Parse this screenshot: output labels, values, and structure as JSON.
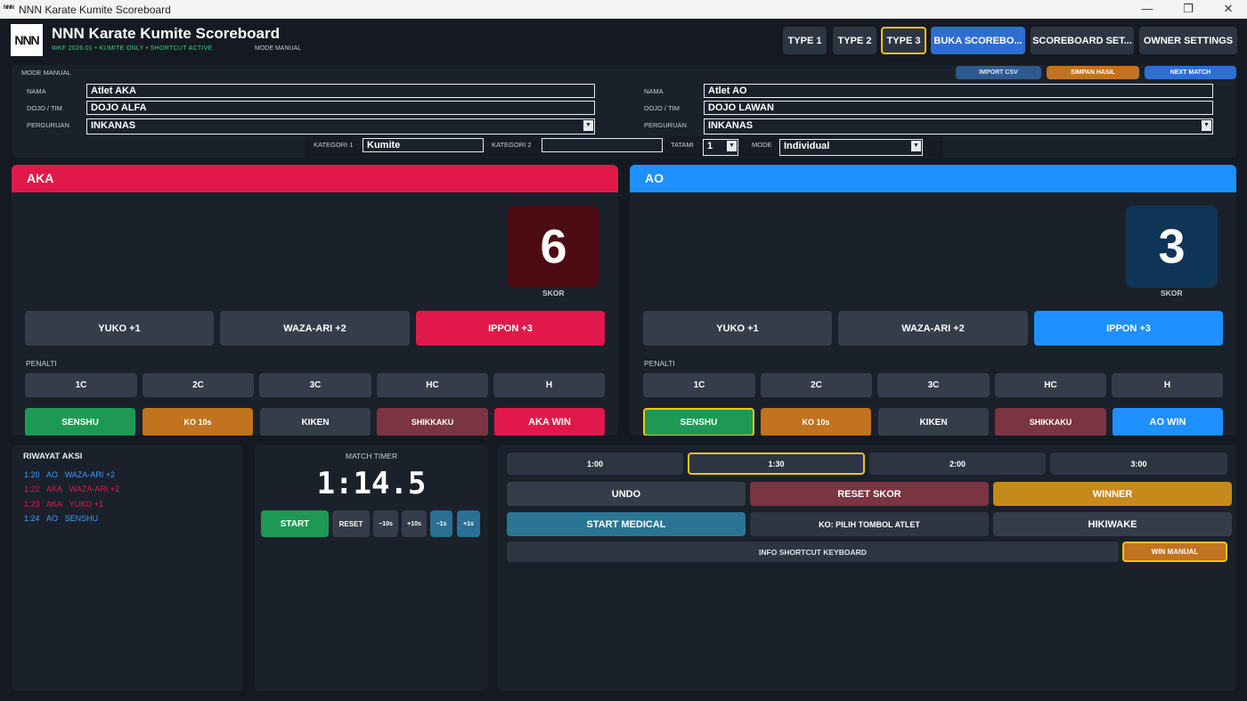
{
  "window": {
    "title": "NNN Karate Kumite Scoreboard",
    "icon_text": "NNN",
    "controls": [
      "minimize-icon",
      "maximize-icon",
      "close-icon"
    ]
  },
  "header": {
    "logo": "NNN",
    "title": "NNN Karate Kumite Scoreboard",
    "subtitle": "WKF 2026.01 • KUMITE ONLY • SHORTCUT ACTIVE",
    "mode": "MODE MANUAL",
    "buttons": {
      "type1": "TYPE 1",
      "type2": "TYPE 2",
      "type3": "TYPE 3",
      "open_scoreboard": "BUKA SCOREBO...",
      "scoreboard_settings": "SCOREBOARD SET...",
      "owner_settings": "OWNER SETTINGS"
    },
    "selected_type": "TYPE 3"
  },
  "info": {
    "mode_label": "MODE MANUAL",
    "import_csv": "IMPORT CSV",
    "save_result": "SIMPAN HASIL",
    "next_match": "NEXT MATCH",
    "aka": {
      "name_label": "NAMA",
      "name": "Atlet AKA",
      "dojo_label": "DOJO / TIM",
      "dojo": "DOJO ALFA",
      "school_label": "PERGURUAN",
      "school": "INKANAS"
    },
    "ao": {
      "name_label": "NAMA",
      "name": "Atlet AO",
      "dojo_label": "DOJO / TIM",
      "dojo": "DOJO LAWAN",
      "school_label": "PERGURUAN",
      "school": "INKANAS"
    },
    "category1_label": "KATEGORI 1",
    "category1": "Kumite",
    "category2_label": "KATEGORI 2",
    "category2": "",
    "tatami_label": "TATAMI",
    "tatami": "1",
    "mode_select_label": "MODE",
    "mode_select": "Individual"
  },
  "aka": {
    "header": "AKA",
    "score": "6",
    "score_label": "SKOR",
    "yuko": "YUKO  +1",
    "waza_ari": "WAZA-ARI  +2",
    "ippon": "IPPON  +3",
    "penalty_label": "PENALTI",
    "penalties": [
      "1C",
      "2C",
      "3C",
      "HC",
      "H"
    ],
    "senshu": "SENSHU",
    "ko": "KO 10s",
    "kiken": "KIKEN",
    "shikkaku": "SHIKKAKU",
    "win": "AKA WIN"
  },
  "ao": {
    "header": "AO",
    "score": "3",
    "score_label": "SKOR",
    "yuko": "YUKO  +1",
    "waza_ari": "WAZA-ARI  +2",
    "ippon": "IPPON  +3",
    "penalty_label": "PENALTI",
    "penalties": [
      "1C",
      "2C",
      "3C",
      "HC",
      "H"
    ],
    "senshu": "SENSHU",
    "ko": "KO 10s",
    "kiken": "KIKEN",
    "shikkaku": "SHIKKAKU",
    "win": "AO WIN"
  },
  "history": {
    "title": "RIWAYAT AKSI",
    "entries": [
      {
        "time": "1:20",
        "side": "AO",
        "action": "WAZA-ARI +2"
      },
      {
        "time": "1:22",
        "side": "AKA",
        "action": "WAZA-ARI +2"
      },
      {
        "time": "1:23",
        "side": "AKA",
        "action": "YUKO +1"
      },
      {
        "time": "1:24",
        "side": "AO",
        "action": "SENSHU"
      }
    ]
  },
  "timer": {
    "title": "MATCH TIMER",
    "value": "1:14.5",
    "start": "START",
    "reset": "RESET",
    "minus10": "−10s",
    "plus10": "+10s",
    "minus1": "−1s",
    "plus1": "+1s"
  },
  "controls": {
    "durations": [
      "1:00",
      "1:30",
      "2:00",
      "3:00"
    ],
    "selected_duration": "1:30",
    "undo": "UNDO",
    "reset_score": "RESET SKOR",
    "winner": "WINNER",
    "start_medical": "START MEDICAL",
    "ko_pick": "KO: PILIH TOMBOL ATLET",
    "hikiwake": "HIKIWAKE",
    "shortcut_info": "INFO SHORTCUT KEYBOARD",
    "win_manual": "WIN MANUAL"
  },
  "colors": {
    "aka": "#e0194a",
    "ao": "#1e90ff",
    "selected_outline": "#f0c419",
    "senshu": "#1e9955",
    "ko": "#c1731f",
    "shikkaku": "#7a3540",
    "medical": "#2a7594",
    "winner": "#c68a1c"
  }
}
